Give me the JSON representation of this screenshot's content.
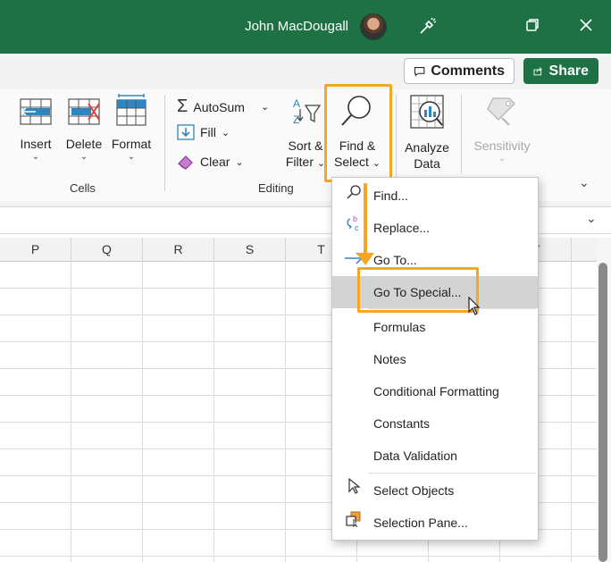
{
  "titlebar": {
    "user_name": "John MacDougall",
    "icons": [
      "avatar",
      "pen-icon",
      "restore-icon",
      "close-icon"
    ]
  },
  "toolbar": {
    "comments_label": "Comments",
    "share_label": "Share"
  },
  "ribbon": {
    "cells_group": {
      "label": "Cells",
      "insert_label": "Insert",
      "delete_label": "Delete",
      "format_label": "Format"
    },
    "editing_group": {
      "label": "Editing",
      "autosum_label": "AutoSum",
      "fill_label": "Fill",
      "clear_label": "Clear",
      "sort_filter_line1": "Sort &",
      "sort_filter_line2": "Filter",
      "find_select_line1": "Find &",
      "find_select_line2": "Select"
    },
    "analysis": {
      "analyze_line1": "Analyze",
      "analyze_line2": "Data"
    },
    "sensitivity": {
      "label": "Sensitivity"
    }
  },
  "sheet": {
    "columns": [
      "P",
      "Q",
      "R",
      "S",
      "T",
      "",
      "",
      "V"
    ]
  },
  "menu": {
    "items": [
      {
        "label": "Find...",
        "icon": "search-icon"
      },
      {
        "label": "Replace...",
        "icon": "replace-icon"
      },
      {
        "label": "Go To...",
        "icon": "goto-arrow-icon"
      },
      {
        "label": "Go To Special...",
        "icon": ""
      },
      {
        "label": "Formulas",
        "icon": ""
      },
      {
        "label": "Notes",
        "icon": ""
      },
      {
        "label": "Conditional Formatting",
        "icon": ""
      },
      {
        "label": "Constants",
        "icon": ""
      },
      {
        "label": "Data Validation",
        "icon": ""
      },
      {
        "label": "Select Objects",
        "icon": "select-objects-icon"
      },
      {
        "label": "Selection Pane...",
        "icon": "selection-pane-icon"
      }
    ],
    "highlighted_index": 3
  },
  "colors": {
    "brand_green": "#1e7145",
    "highlight_orange": "#f5a623"
  }
}
